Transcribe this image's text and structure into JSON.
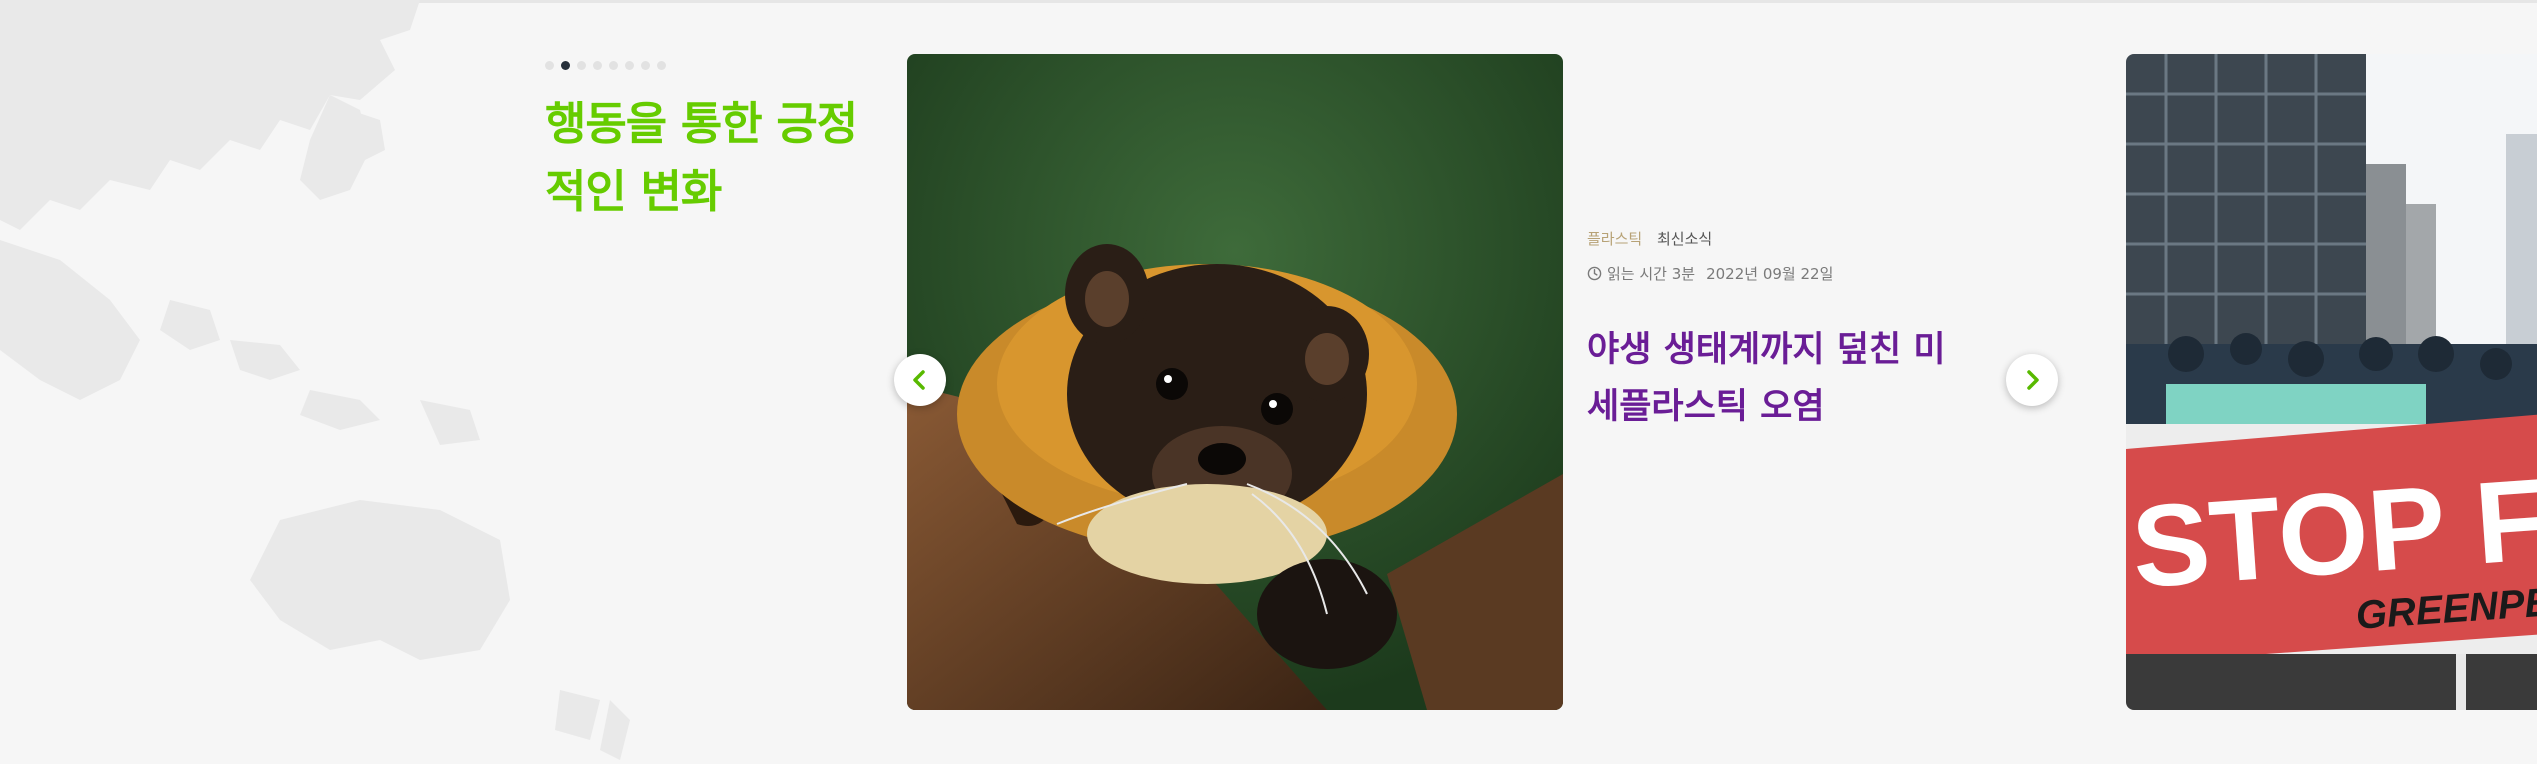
{
  "carousel": {
    "pages": 8,
    "active_page": 2
  },
  "section": {
    "title": "행동을 통한 긍정적인 변화"
  },
  "card": {
    "category": "플라스틱",
    "tag": "최신소식",
    "reading_time": "읽는 시간 3분",
    "date": "2022년 09월 22일",
    "title": "야생 생태계까지 덮친 미세플라스틱 오염"
  },
  "next_card": {
    "banner_text": "STOP FAIL",
    "banner_sub": "GREENPE"
  },
  "colors": {
    "accent_green": "#66cc00",
    "title_purple": "#6a1d96",
    "category_gold": "#b7a276"
  },
  "icons": {
    "prev": "chevron-left-icon",
    "next": "chevron-right-icon",
    "clock": "clock-icon"
  }
}
